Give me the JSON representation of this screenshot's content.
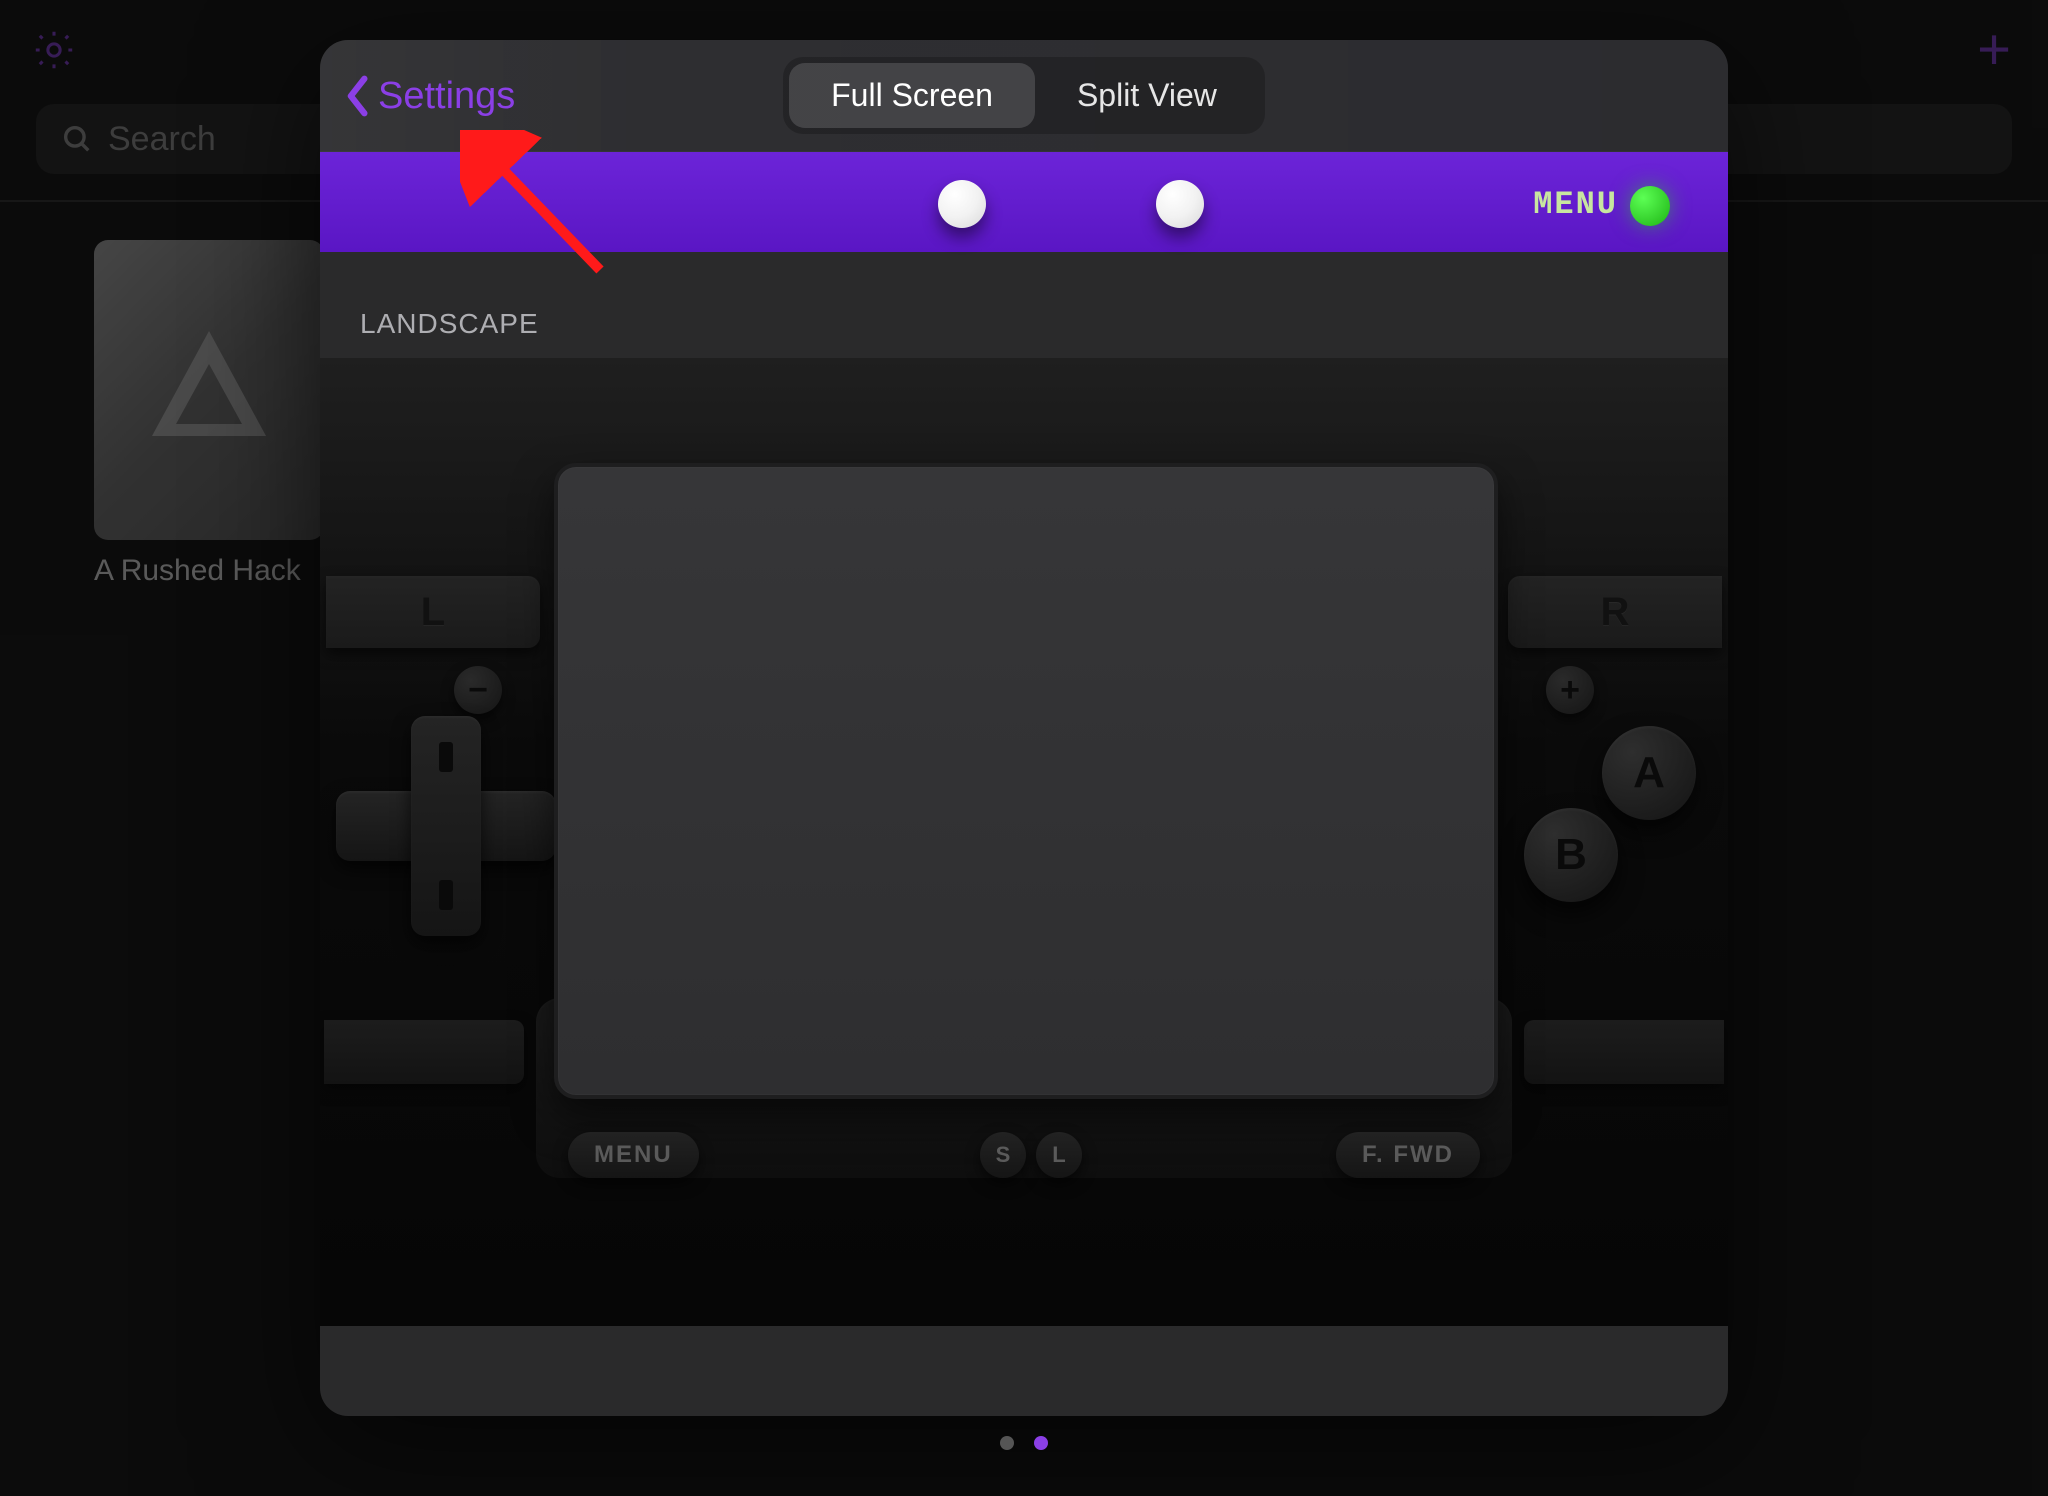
{
  "background": {
    "search_placeholder": "Search",
    "game_title": "A Rushed Hack"
  },
  "modal": {
    "back_label": "Settings",
    "segments": {
      "full_screen": "Full Screen",
      "split_view": "Split View"
    },
    "top_strip": {
      "menu_label": "MENU"
    },
    "section_header": "LANDSCAPE",
    "buttons": {
      "L": "L",
      "R": "R",
      "minus": "−",
      "plus": "+",
      "A": "A",
      "B": "B",
      "menu": "MENU",
      "ffwd": "F. FWD",
      "S": "S",
      "Lsm": "L"
    }
  },
  "colors": {
    "accent": "#8b3fe6",
    "purple_strip": "#5a16c4",
    "toggle_on": "#1db314",
    "arrow": "#ff1a1a"
  }
}
